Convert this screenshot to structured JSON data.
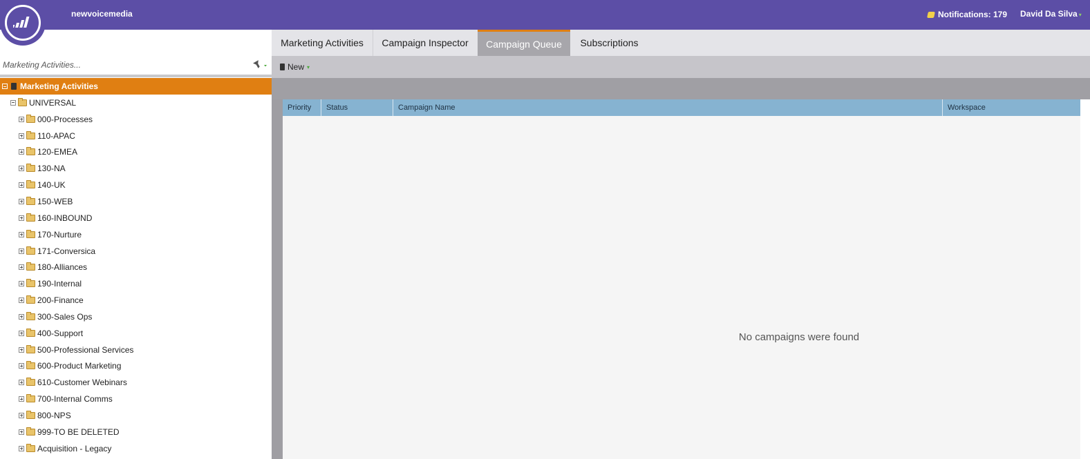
{
  "header": {
    "brand": "newvoicemedia",
    "notifications_label": "Notifications: 179",
    "user_name": "David Da Silva",
    "logo_icon": "marketo-bars-icon",
    "notification_icon": "note-icon",
    "colors": {
      "bar": "#5c4ea6",
      "accent": "#e07f12"
    }
  },
  "sidebar": {
    "search_placeholder": "Marketing Activities...",
    "root_label": "Marketing Activities",
    "group_label": "UNIVERSAL",
    "folders": [
      "000-Processes",
      "110-APAC",
      "120-EMEA",
      "130-NA",
      "140-UK",
      "150-WEB",
      "160-INBOUND",
      "170-Nurture",
      "171-Conversica",
      "180-Alliances",
      "190-Internal",
      "200-Finance",
      "300-Sales Ops",
      "400-Support",
      "500-Professional Services",
      "600-Product Marketing",
      "610-Customer Webinars",
      "700-Internal Comms",
      "800-NPS",
      "999-TO BE DELETED",
      "Acquisition - Legacy"
    ]
  },
  "tabs": [
    {
      "label": "Marketing Activities",
      "active": false
    },
    {
      "label": "Campaign Inspector",
      "active": false
    },
    {
      "label": "Campaign Queue",
      "active": true
    },
    {
      "label": "Subscriptions",
      "active": false
    }
  ],
  "toolbar": {
    "new_label": "New"
  },
  "grid": {
    "columns": [
      "Priority",
      "Status",
      "Campaign Name",
      "Workspace"
    ],
    "empty_message": "No campaigns were found"
  }
}
